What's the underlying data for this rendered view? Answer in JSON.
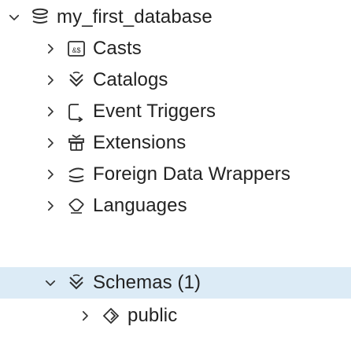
{
  "tree": {
    "root": {
      "label": "my_first_database",
      "icon": "database-icon",
      "expanded": true
    },
    "children": [
      {
        "label": "Casts",
        "icon": "cast-icon",
        "expanded": false
      },
      {
        "label": "Catalogs",
        "icon": "catalog-icon",
        "expanded": false
      },
      {
        "label": "Event Triggers",
        "icon": "event-trigger-icon",
        "expanded": false
      },
      {
        "label": "Extensions",
        "icon": "extension-icon",
        "expanded": false
      },
      {
        "label": "Foreign Data Wrappers",
        "icon": "foreign-data-wrapper-icon",
        "expanded": false
      },
      {
        "label": "Languages",
        "icon": "language-icon",
        "expanded": false
      },
      {
        "label": "Schemas (1)",
        "icon": "schema-icon",
        "expanded": true,
        "selected": true
      }
    ],
    "schemas": [
      {
        "label": "public",
        "icon": "schema-public-icon",
        "expanded": false
      }
    ]
  },
  "colors": {
    "selected_row": "#dcebf6",
    "icon_stroke": "#2f2f2f",
    "text": "#222222"
  }
}
